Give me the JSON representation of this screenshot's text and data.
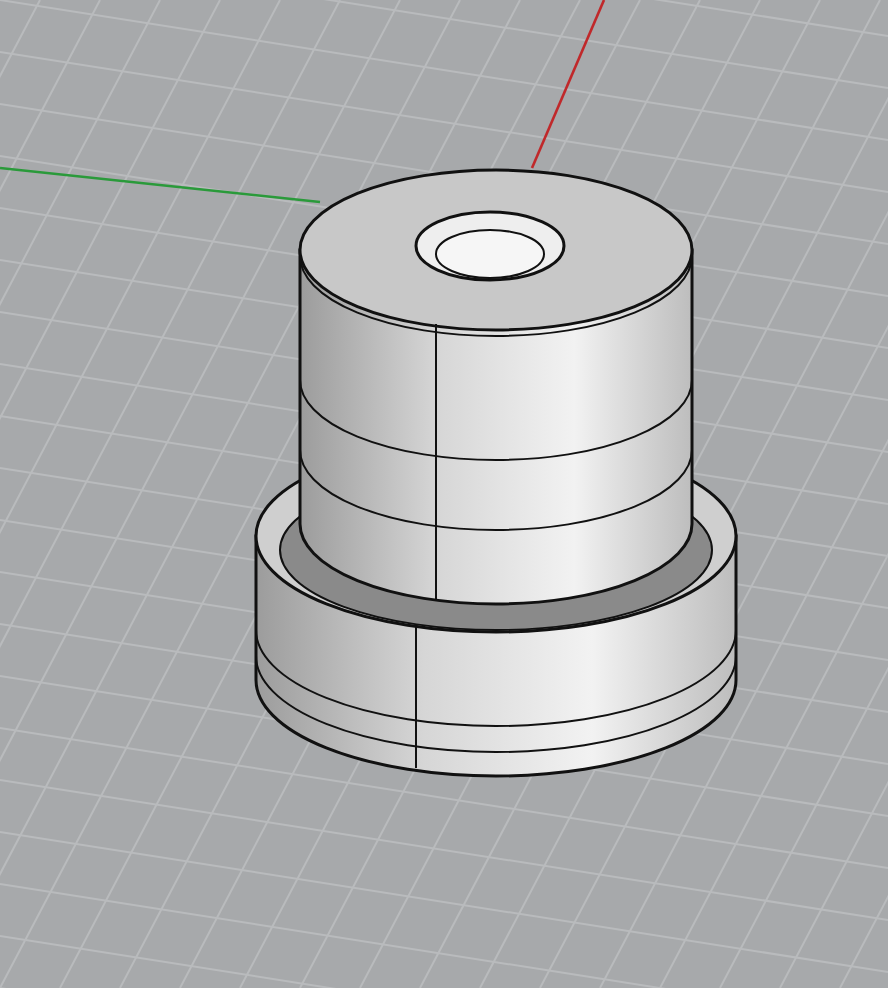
{
  "viewport": {
    "axes": [
      {
        "kind": "x",
        "color": "#c0282a"
      },
      {
        "kind": "y",
        "color": "#2a9a3a"
      }
    ]
  }
}
